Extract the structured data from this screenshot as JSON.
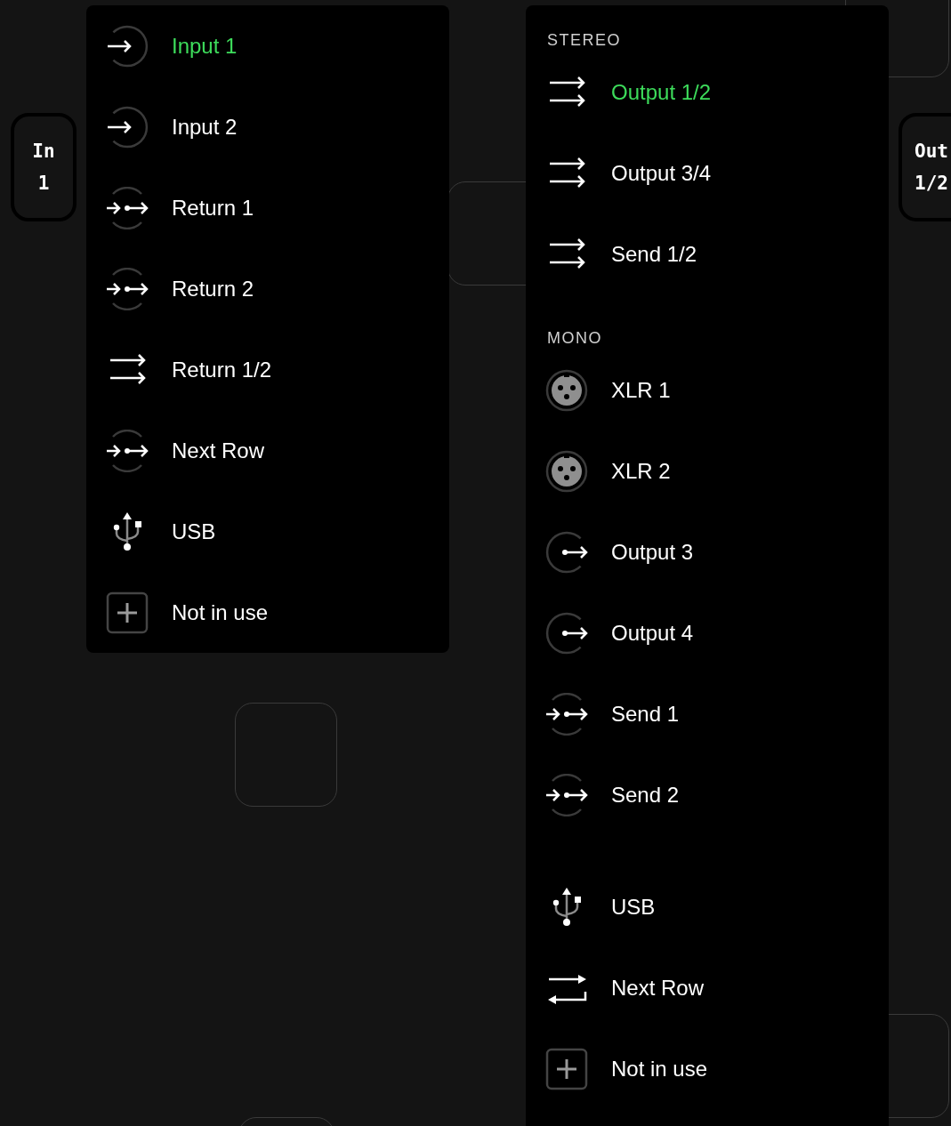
{
  "nodes": [
    {
      "title": "In",
      "number": "1"
    },
    {
      "title": "Out",
      "number": "1/2"
    }
  ],
  "input_menu": {
    "items": [
      {
        "label": "Input 1",
        "kind": "input",
        "selected": true
      },
      {
        "label": "Input 2",
        "kind": "input",
        "selected": false
      },
      {
        "label": "Return 1",
        "kind": "through",
        "selected": false
      },
      {
        "label": "Return 2",
        "kind": "through",
        "selected": false
      },
      {
        "label": "Return 1/2",
        "kind": "stereo",
        "selected": false
      },
      {
        "label": "Next Row",
        "kind": "through",
        "selected": false
      },
      {
        "label": "USB",
        "kind": "usb",
        "selected": false
      },
      {
        "label": "Not in use",
        "kind": "add",
        "selected": false
      }
    ]
  },
  "output_menu": {
    "sections": [
      {
        "header": "STEREO",
        "items": [
          {
            "label": "Output 1/2",
            "kind": "stereo",
            "selected": true
          },
          {
            "label": "Output 3/4",
            "kind": "stereo",
            "selected": false
          },
          {
            "label": "Send 1/2",
            "kind": "stereo",
            "selected": false
          }
        ]
      },
      {
        "header": "MONO",
        "items": [
          {
            "label": "XLR 1",
            "kind": "xlr",
            "selected": false
          },
          {
            "label": "XLR 2",
            "kind": "xlr",
            "selected": false
          },
          {
            "label": "Output 3",
            "kind": "output",
            "selected": false
          },
          {
            "label": "Output 4",
            "kind": "output",
            "selected": false
          },
          {
            "label": "Send 1",
            "kind": "through",
            "selected": false
          },
          {
            "label": "Send 2",
            "kind": "through",
            "selected": false
          }
        ]
      },
      {
        "items": [
          {
            "label": "USB",
            "kind": "usb",
            "selected": false
          },
          {
            "label": "Next Row",
            "kind": "loop",
            "selected": false
          },
          {
            "label": "Not in use",
            "kind": "add",
            "selected": false
          }
        ]
      }
    ]
  }
}
